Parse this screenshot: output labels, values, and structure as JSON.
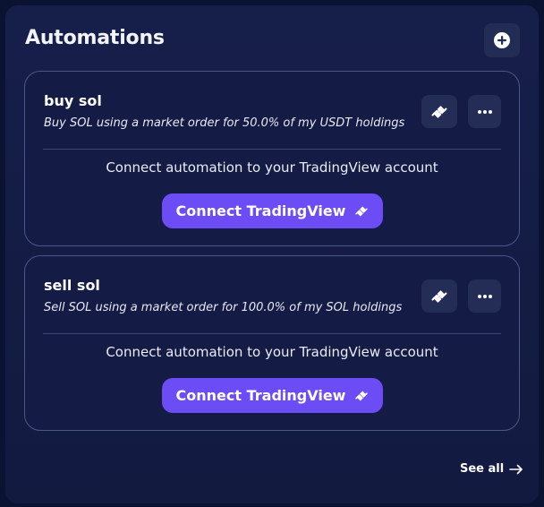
{
  "header": {
    "title": "Automations",
    "add_icon": "plus-circle-icon"
  },
  "automations": [
    {
      "name": "buy sol",
      "description": "Buy SOL using a market order for 50.0% of my USDT holdings",
      "connect_prompt": "Connect automation to your TradingView account",
      "connect_label": "Connect TradingView",
      "link_icon": "plug-link-icon",
      "more_icon": "ellipsis-icon"
    },
    {
      "name": "sell sol",
      "description": "Sell SOL using a market order for 100.0% of my SOL holdings",
      "connect_prompt": "Connect automation to your TradingView account",
      "connect_label": "Connect TradingView",
      "link_icon": "plug-link-icon",
      "more_icon": "ellipsis-icon"
    }
  ],
  "footer": {
    "see_all_label": "See all",
    "arrow_icon": "arrow-right-icon"
  },
  "colors": {
    "background": "#0b1333",
    "panel": "#161f4a",
    "card_border": "#4b5788",
    "accent": "#6c4cf4",
    "icon_button": "#242d56"
  }
}
